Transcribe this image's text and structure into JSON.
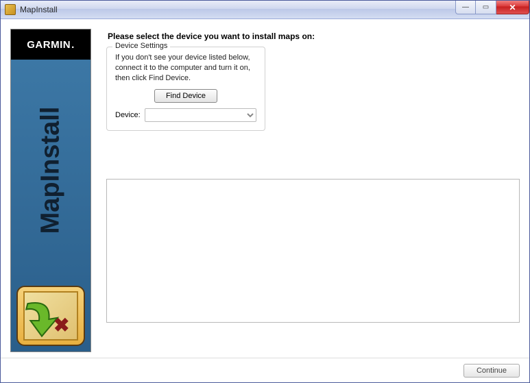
{
  "titlebar": {
    "title": "MapInstall"
  },
  "sidebar": {
    "brand": "GARMIN",
    "brand_suffix": ".",
    "product_name": "MapInstall"
  },
  "main": {
    "heading": "Please select the device you want to install maps on:",
    "device_settings": {
      "legend": "Device Settings",
      "instruction": "If you don't see your device listed below, connect it to the computer and turn it on, then click Find Device.",
      "find_button_label": "Find Device",
      "device_label": "Device:",
      "device_selected": ""
    }
  },
  "footer": {
    "continue_label": "Continue"
  },
  "window_controls": {
    "minimize": "—",
    "maximize": "▭",
    "close": "✕"
  }
}
